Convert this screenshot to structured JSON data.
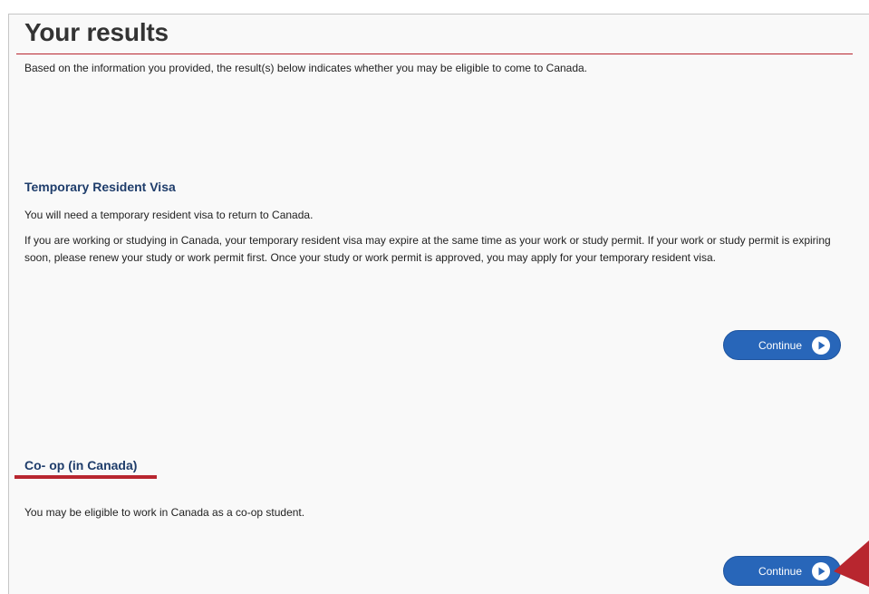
{
  "header": {
    "title": "Your results",
    "intro": "Based on the information you provided, the result(s) below indicates whether you may be eligible to come to Canada."
  },
  "results": [
    {
      "title": "Temporary Resident Visa",
      "paragraphs": [
        "You will need a temporary resident visa to return to Canada.",
        "If you are working or studying in Canada, your temporary resident visa may expire at the same time as your work or study permit. If your work or study permit is expiring soon, please renew your study or work permit first. Once your study or work permit is approved, you may apply for your temporary resident visa."
      ],
      "button_label": "Continue"
    },
    {
      "title": "Co- op (in Canada)",
      "paragraphs": [
        "You may be eligible to work in Canada as a co-op student."
      ],
      "button_label": "Continue"
    }
  ],
  "colors": {
    "accent_red": "#b8262f",
    "button_blue": "#2866b9",
    "heading_navy": "#1f3d6b"
  },
  "icons": {
    "button_icon": "play-circle-icon",
    "annotation": "pointer-arrow-icon"
  }
}
